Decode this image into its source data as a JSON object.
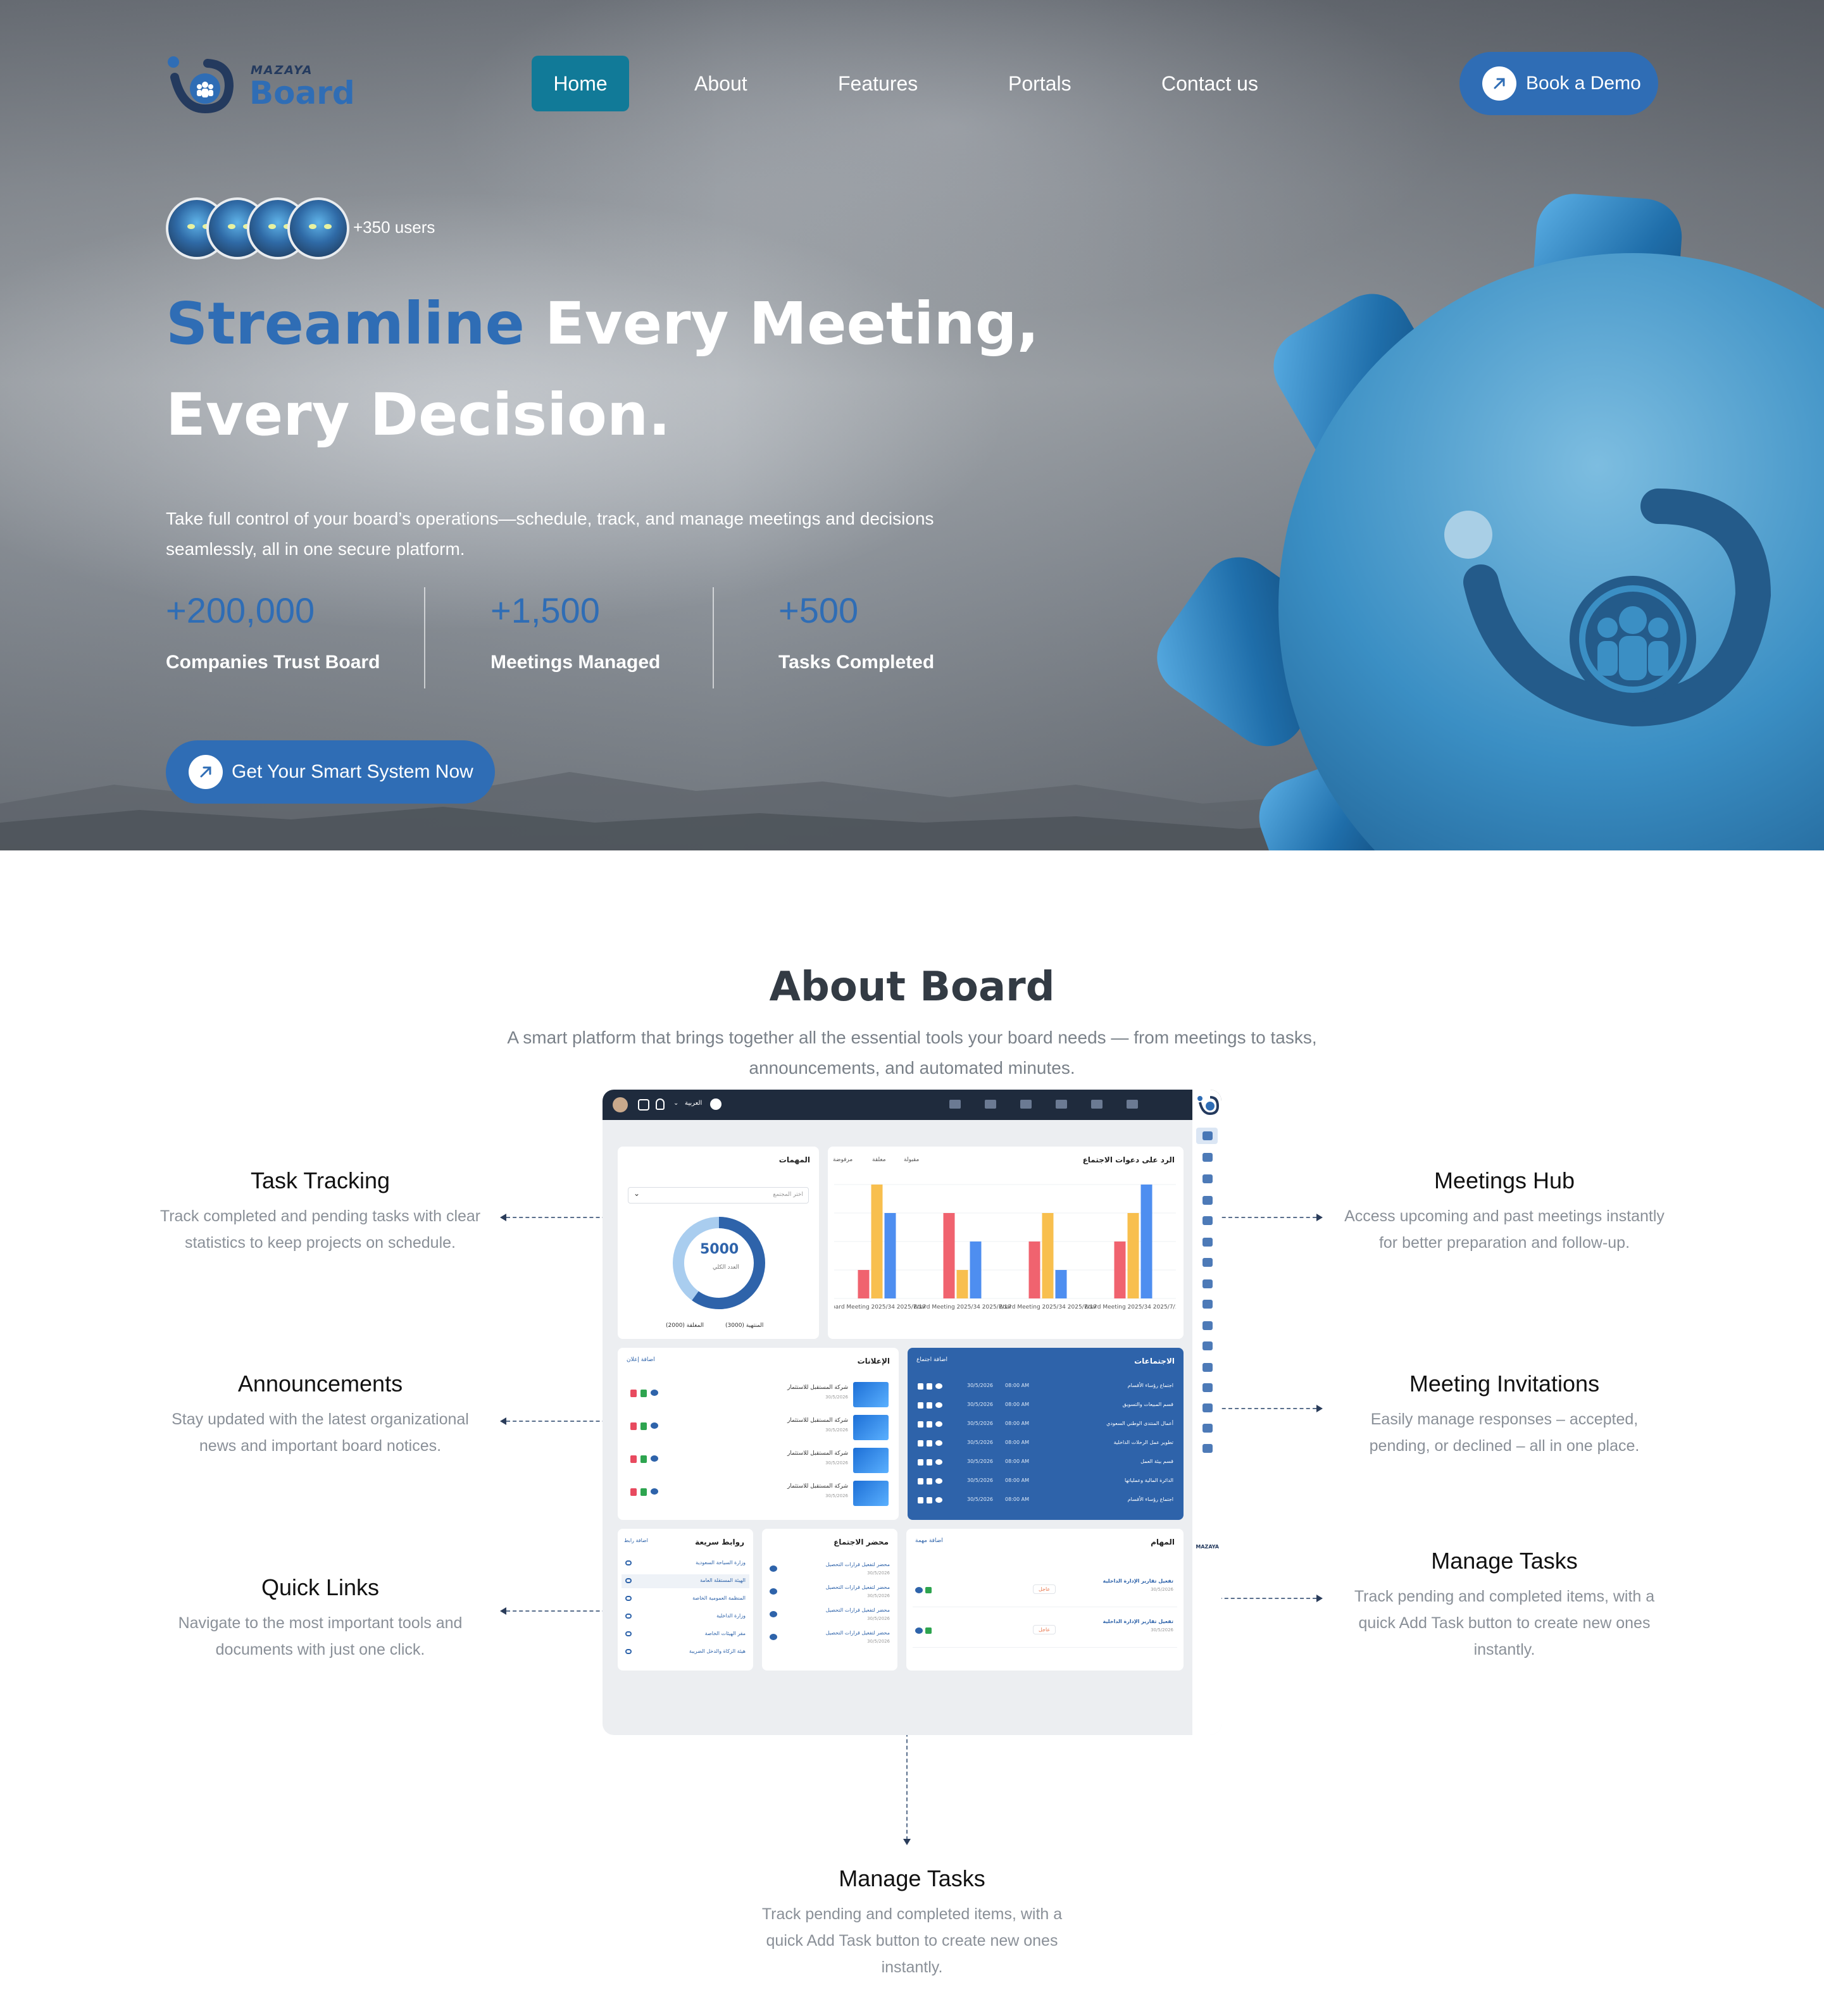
{
  "brand": {
    "small": "MAZAYA",
    "name": "Board"
  },
  "nav": {
    "items": [
      {
        "label": "Home",
        "active": true
      },
      {
        "label": "About",
        "active": false
      },
      {
        "label": "Features",
        "active": false
      },
      {
        "label": "Portals",
        "active": false
      },
      {
        "label": "Contact us",
        "active": false
      }
    ],
    "demo_label": "Book a Demo"
  },
  "hero": {
    "users_label": "+350 users",
    "title_highlight": "Streamline",
    "title_rest_line1": " Every Meeting,",
    "title_line2": "Every Decision.",
    "description": "Take full control of your board’s operations—schedule, track, and manage meetings and decisions seamlessly, all in one secure platform.",
    "stats": [
      {
        "value": "+200,000",
        "caption": "Companies Trust Board"
      },
      {
        "value": "+1,500",
        "caption": "Meetings Managed"
      },
      {
        "value": "+500",
        "caption": "Tasks Completed"
      }
    ],
    "cta_label": "Get Your Smart System Now"
  },
  "about": {
    "title": "About Board",
    "subtitle": "A smart platform that brings together all the essential tools your board needs — from meetings to tasks, announcements, and automated minutes.",
    "features_left": [
      {
        "title": "Task Tracking",
        "desc": "Track completed and pending tasks with clear statistics to keep projects on schedule."
      },
      {
        "title": "Announcements",
        "desc": "Stay updated with the latest organizational news and important board notices."
      },
      {
        "title": "Quick Links",
        "desc": "Navigate to the most important tools and documents with just one click."
      }
    ],
    "features_right": [
      {
        "title": "Meetings Hub",
        "desc": "Access upcoming and past meetings instantly for better preparation and follow-up."
      },
      {
        "title": "Meeting Invitations",
        "desc": "Easily manage responses – accepted, pending, or declined – all in one place."
      },
      {
        "title": "Manage Tasks",
        "desc": "Track pending and completed items, with a quick Add Task button to create new ones instantly."
      }
    ],
    "feature_bottom": {
      "title": "Manage Tasks",
      "desc": "Track pending and completed items, with a quick Add Task button to create new ones instantly."
    }
  },
  "dashboard": {
    "lang": "العربية",
    "tasks_title": "المهمات",
    "tasks_filter": "اختر المجتمع",
    "donut_value": "5000",
    "donut_caption": "العدد الكلي",
    "donut_legend": [
      "المنتهية (3000)",
      "المغلقة (2000)"
    ],
    "invites_title": "الرد على دعوات الاجتماع",
    "invites_legend": [
      "مقبولة",
      "معلقة",
      "مرفوضة"
    ],
    "chart_data": {
      "type": "bar",
      "categories": [
        "Board Meeting 2025/34 2025/7/17",
        "Board Meeting 2025/34 2025/7/17",
        "Board Meeting 2025/34 2025/7/17",
        "Board Meeting 2025/34 2025/7/17"
      ],
      "series": [
        {
          "name": "مرفوضة",
          "color": "#f0636f",
          "values": [
            25,
            75,
            50,
            50
          ]
        },
        {
          "name": "معلقة",
          "color": "#f8bf4e",
          "values": [
            100,
            25,
            75,
            75
          ]
        },
        {
          "name": "مقبولة",
          "color": "#4e8ef0",
          "values": [
            75,
            50,
            25,
            100
          ]
        }
      ],
      "ylim": [
        0,
        100
      ]
    },
    "announcements_title": "الإعلانات",
    "announcements_add": "اضافة إعلان",
    "announcement_item": "شركة المستقبل للاستثمار",
    "announcement_date": "30/5/2026",
    "meetings_title": "الاجتماعات",
    "meetings_add": "اضافة اجتماع",
    "meetings_rows": [
      {
        "name": "اجتماع رؤساء الأقسام",
        "date": "30/5/2026",
        "time": "08:00 AM"
      },
      {
        "name": "قسم المبيعات والتسويق",
        "date": "30/5/2026",
        "time": "08:00 AM"
      },
      {
        "name": "أعمال المنتدى الوطني السعودي",
        "date": "30/5/2026",
        "time": "08:00 AM"
      },
      {
        "name": "تطوير عمل الرحلات الداخلية",
        "date": "30/5/2026",
        "time": "08:00 AM"
      },
      {
        "name": "قسم بيئة العمل",
        "date": "30/5/2026",
        "time": "08:00 AM"
      },
      {
        "name": "الدائرة المالية وعملياتها",
        "date": "30/5/2026",
        "time": "08:00 AM"
      },
      {
        "name": "اجتماع رؤساء الأقسام",
        "date": "30/5/2026",
        "time": "08:00 AM"
      }
    ],
    "links_title": "روابط سريعة",
    "links_add": "اضافة رابط",
    "links": [
      "وزارة السياحة السعودية",
      "الهيئة المستقلة العامة",
      "المنظمة العمومية الخاصة",
      "وزارة الداخلية",
      "مقر الهيئات الخاصة",
      "هيئة الزكاة والدخل الضريبة"
    ],
    "minutes_title": "محضر الاجتماع",
    "minutes_item": "محضر لتفعيل قرارات التحصيل",
    "minutes_date": "30/5/2026",
    "tasks2_title": "المهام",
    "tasks2_add": "اضافة مهمة",
    "tasks2_item": "تفعيل تقارير الإدارة الداخلية",
    "tasks2_date": "30/5/2026",
    "tasks2_status": "عاجل",
    "brand_mark": "MAZAYA"
  },
  "colors": {
    "accent": "#2f6db5",
    "nav_active": "#117a98",
    "heading": "#333b44",
    "muted": "#8a9098"
  }
}
